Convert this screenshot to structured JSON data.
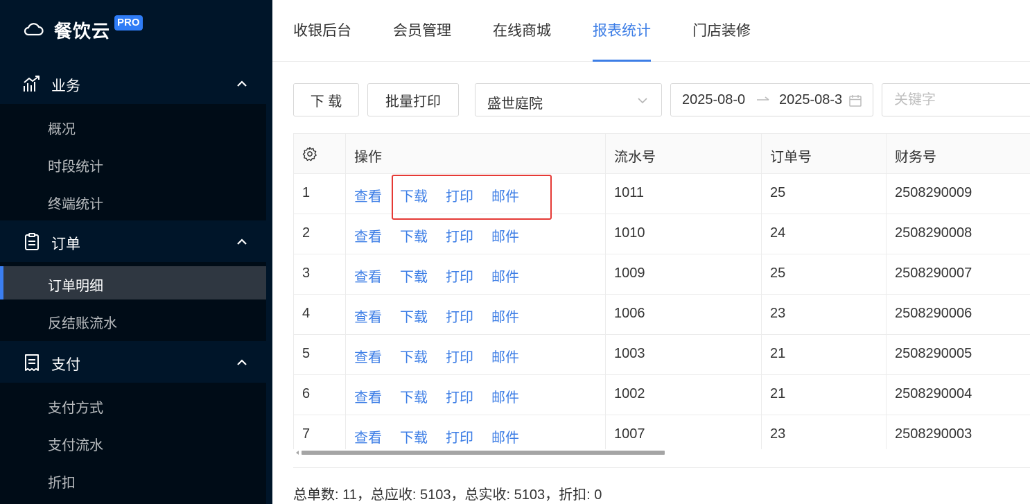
{
  "sidebar": {
    "brand": "餐饮云",
    "badge": "PRO",
    "groups": [
      {
        "label": "业务",
        "icon": "chart-line-icon",
        "items": [
          "概况",
          "时段统计",
          "终端统计"
        ]
      },
      {
        "label": "订单",
        "icon": "clipboard-icon",
        "items": [
          "订单明细",
          "反结账流水"
        ]
      },
      {
        "label": "支付",
        "icon": "receipt-icon",
        "items": [
          "支付方式",
          "支付流水",
          "折扣"
        ]
      }
    ],
    "active_item": "订单明细"
  },
  "topnav": {
    "tabs": [
      "收银后台",
      "会员管理",
      "在线商城",
      "报表统计",
      "门店装修"
    ],
    "active_tab": "报表统计"
  },
  "toolbar": {
    "download_label": "下 载",
    "batch_print_label": "批量打印",
    "store_select": "盛世庭院",
    "date_start": "2025-08-0",
    "date_end": "2025-08-3",
    "keyword_placeholder": "关键字"
  },
  "table": {
    "columns": [
      "操作",
      "流水号",
      "订单号",
      "财务号"
    ],
    "actions": [
      "查看",
      "下载",
      "打印",
      "邮件"
    ],
    "rows": [
      {
        "index": "1",
        "serial": "1011",
        "order": "25",
        "finance": "2508290009"
      },
      {
        "index": "2",
        "serial": "1010",
        "order": "24",
        "finance": "2508290008"
      },
      {
        "index": "3",
        "serial": "1009",
        "order": "25",
        "finance": "2508290007"
      },
      {
        "index": "4",
        "serial": "1006",
        "order": "23",
        "finance": "2508290006"
      },
      {
        "index": "5",
        "serial": "1003",
        "order": "21",
        "finance": "2508290005"
      },
      {
        "index": "6",
        "serial": "1002",
        "order": "21",
        "finance": "2508290004"
      },
      {
        "index": "7",
        "serial": "1007",
        "order": "23",
        "finance": "2508290003"
      }
    ]
  },
  "summary": "总单数: 11，总应收: 5103，总实收: 5103，折扣: 0",
  "colors": {
    "sidebar_bg": "#001529",
    "submenu_bg": "#000c17",
    "accent": "#3d7ee6",
    "highlight": "#e53935"
  }
}
